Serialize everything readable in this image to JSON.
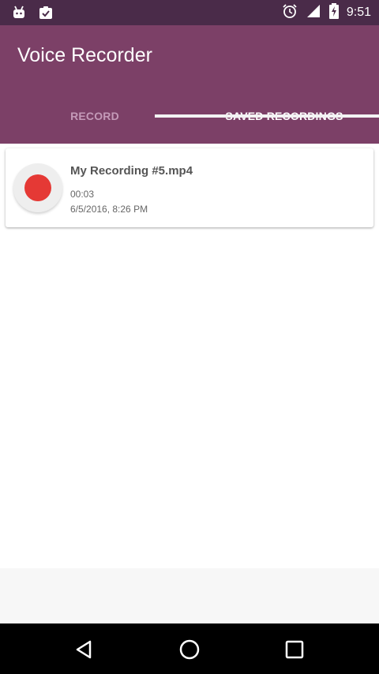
{
  "status_bar": {
    "time": "9:51",
    "left_icons": [
      "android-icon",
      "clipboard-check-icon"
    ],
    "right_icons": [
      "alarm-icon",
      "signal-icon",
      "battery-charging-icon"
    ]
  },
  "app": {
    "title": "Voice Recorder",
    "colors": {
      "primary": "#7c4067",
      "primary_dark": "#4a2b49",
      "record_red": "#e53935"
    }
  },
  "tabs": [
    {
      "label": "RECORD",
      "active": false
    },
    {
      "label": "SAVED RECORDINGS",
      "active": true
    }
  ],
  "recordings": [
    {
      "icon": "record-icon",
      "name": "My Recording #5.mp4",
      "duration": "00:03",
      "date": "6/5/2016, 8:26 PM"
    }
  ],
  "nav_bar": {
    "buttons": [
      "back-icon",
      "home-icon",
      "recents-icon"
    ]
  }
}
